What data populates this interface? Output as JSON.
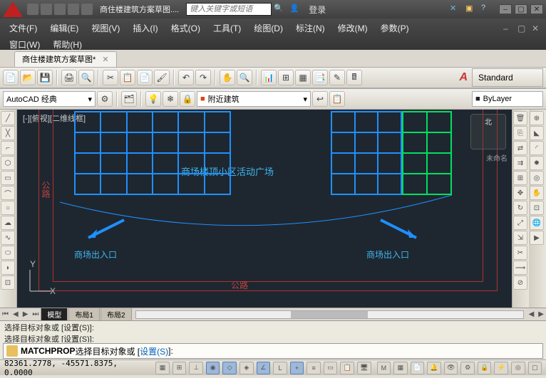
{
  "title": {
    "docname": "商住楼建筑方案草图....",
    "search_placeholder": "键入关键字或短语",
    "login": "登录"
  },
  "menus": [
    "文件(F)",
    "编辑(E)",
    "视图(V)",
    "插入(I)",
    "格式(O)",
    "工具(T)",
    "绘图(D)",
    "标注(N)",
    "修改(M)",
    "参数(P)",
    "窗口(W)",
    "帮助(H)"
  ],
  "file_tab": "商住楼建筑方案草图*",
  "workspace": "AutoCAD 经典",
  "layer_panel_text": "附近建筑",
  "style_current": "Standard",
  "bylayer_text": "ByLayer",
  "canvas": {
    "view_label": "[-][俯视][二维线框]",
    "plaza_text": "商场楼顶小区活动广场",
    "entry_left": "商场出入口",
    "entry_right": "商场出入口",
    "road_vert": "公路",
    "road_horiz": "公路",
    "nav_n": "北",
    "unnamed": "未命名",
    "ucs_y": "Y",
    "ucs_x": "X"
  },
  "layout_tabs": [
    "模型",
    "布局1",
    "布局2"
  ],
  "cmd": {
    "hist1": "选择目标对象或 [设置(S)]:",
    "hist2": "选择目标对象或 [设置(S)]:",
    "cmd_name": "MATCHPROP",
    "cmd_prompt": " 选择目标对象或 [",
    "cmd_opt": "设置(S)",
    "cmd_end": "]:"
  },
  "status": {
    "coords": "82361.2778, -45571.8375, 0.0000"
  }
}
